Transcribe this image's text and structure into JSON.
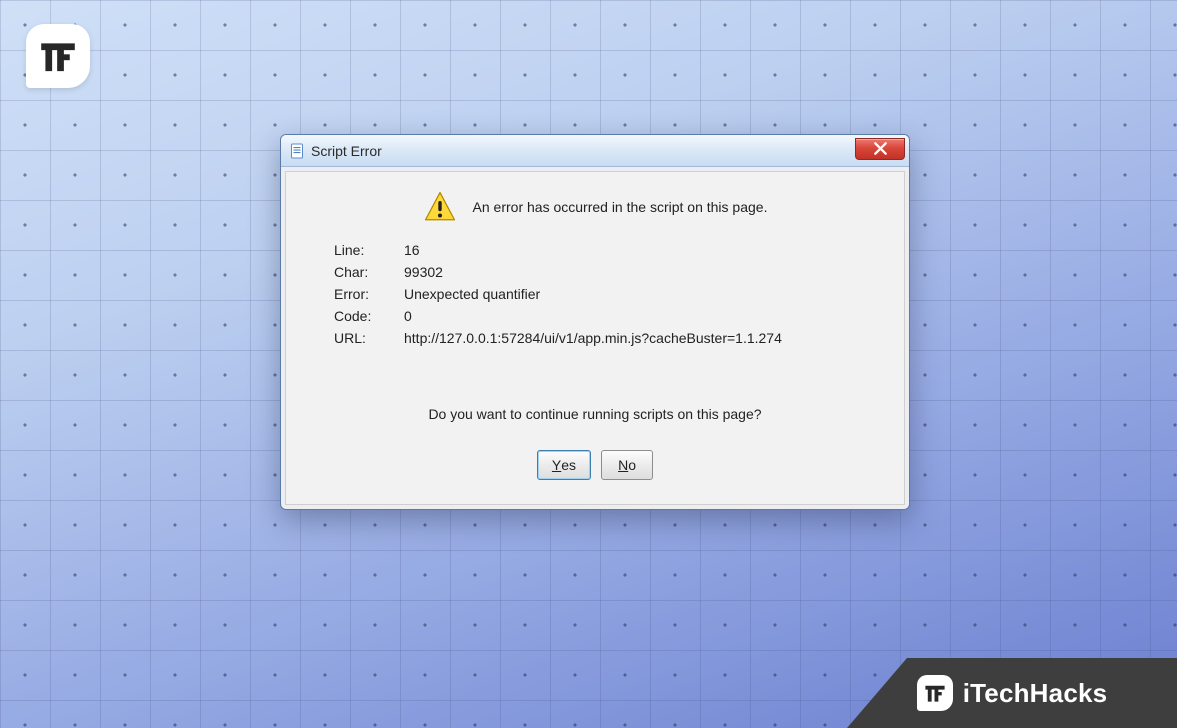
{
  "dialog": {
    "title": "Script Error",
    "headline": "An error has occurred in the script on this page.",
    "labels": {
      "line": "Line:",
      "char": "Char:",
      "error": "Error:",
      "code": "Code:",
      "url": "URL:"
    },
    "values": {
      "line": "16",
      "char": "99302",
      "error": "Unexpected quantifier",
      "code": "0",
      "url": "http://127.0.0.1:57284/ui/v1/app.min.js?cacheBuster=1.1.274"
    },
    "question": "Do you want to continue running scripts on this page?",
    "buttons": {
      "yes": "Yes",
      "no": "No"
    }
  },
  "watermark": {
    "brand": "iTechHacks"
  }
}
